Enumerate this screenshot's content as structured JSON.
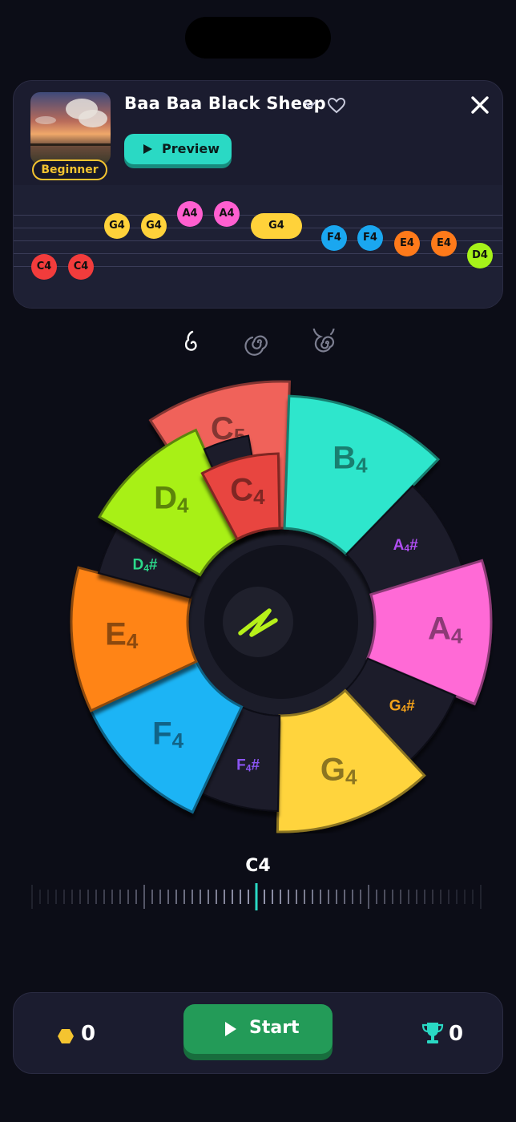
{
  "song": {
    "title": "Baa Baa Black Sheep",
    "level": "Beginner",
    "preview_label": "Preview",
    "cover_icon": "landscape-artwork",
    "favorite_icon": "heart-icon",
    "close_icon": "close-icon"
  },
  "sequence": [
    {
      "note": "C4",
      "color": "#f23c3c"
    },
    {
      "note": "C4",
      "color": "#f23c3c"
    },
    {
      "note": "G4",
      "color": "#ffd23a"
    },
    {
      "note": "G4",
      "color": "#ffd23a"
    },
    {
      "note": "A4",
      "color": "#ff5fd0"
    },
    {
      "note": "A4",
      "color": "#ff5fd0"
    },
    {
      "note": "G4",
      "color": "#ffd23a"
    },
    {
      "note": "F4",
      "color": "#1aa7f0"
    },
    {
      "note": "F4",
      "color": "#1aa7f0"
    },
    {
      "note": "E4",
      "color": "#ff7a1a"
    },
    {
      "note": "E4",
      "color": "#ff7a1a"
    },
    {
      "note": "D4",
      "color": "#a6f219"
    }
  ],
  "spiral_modes": [
    "spiral-small-icon",
    "spiral-medium-icon",
    "spiral-large-icon"
  ],
  "wheel": {
    "center_icon": "bolt-logo-icon",
    "keys": [
      {
        "name": "C",
        "octave": "5",
        "color": "#f0625a"
      },
      {
        "name": "C",
        "octave": "4",
        "color": "#e8453f"
      },
      {
        "name": "B",
        "octave": "4",
        "color": "#2ee6cc"
      },
      {
        "name": "A",
        "octave": "4",
        "sharp": "#",
        "color": "#1b1c2a",
        "label_color": "#b04ef2"
      },
      {
        "name": "A",
        "octave": "4",
        "color": "#ff6ad6"
      },
      {
        "name": "G",
        "octave": "4",
        "sharp": "#",
        "color": "#1b1c2a",
        "label_color": "#f3a21a"
      },
      {
        "name": "G",
        "octave": "4",
        "color": "#ffd43c"
      },
      {
        "name": "F",
        "octave": "4",
        "sharp": "#",
        "color": "#1b1c2a",
        "label_color": "#8a55f2"
      },
      {
        "name": "F",
        "octave": "4",
        "color": "#1fb4f5"
      },
      {
        "name": "E",
        "octave": "4",
        "color": "#ff8419"
      },
      {
        "name": "D",
        "octave": "4",
        "sharp": "#",
        "color": "#1b1c2a",
        "label_color": "#2bd98a"
      },
      {
        "name": "D",
        "octave": "4",
        "color": "#a8f013"
      },
      {
        "name": "C",
        "octave": "4",
        "sharp": "#",
        "color": "#1b1c2a",
        "label_color": "#ff3fb3"
      }
    ]
  },
  "tuner": {
    "current_note": "C4",
    "accent": "#2ad9c4"
  },
  "footer": {
    "coins": "0",
    "start_label": "Start",
    "trophies": "0",
    "coin_icon": "coin-icon",
    "trophy_icon": "trophy-icon"
  }
}
